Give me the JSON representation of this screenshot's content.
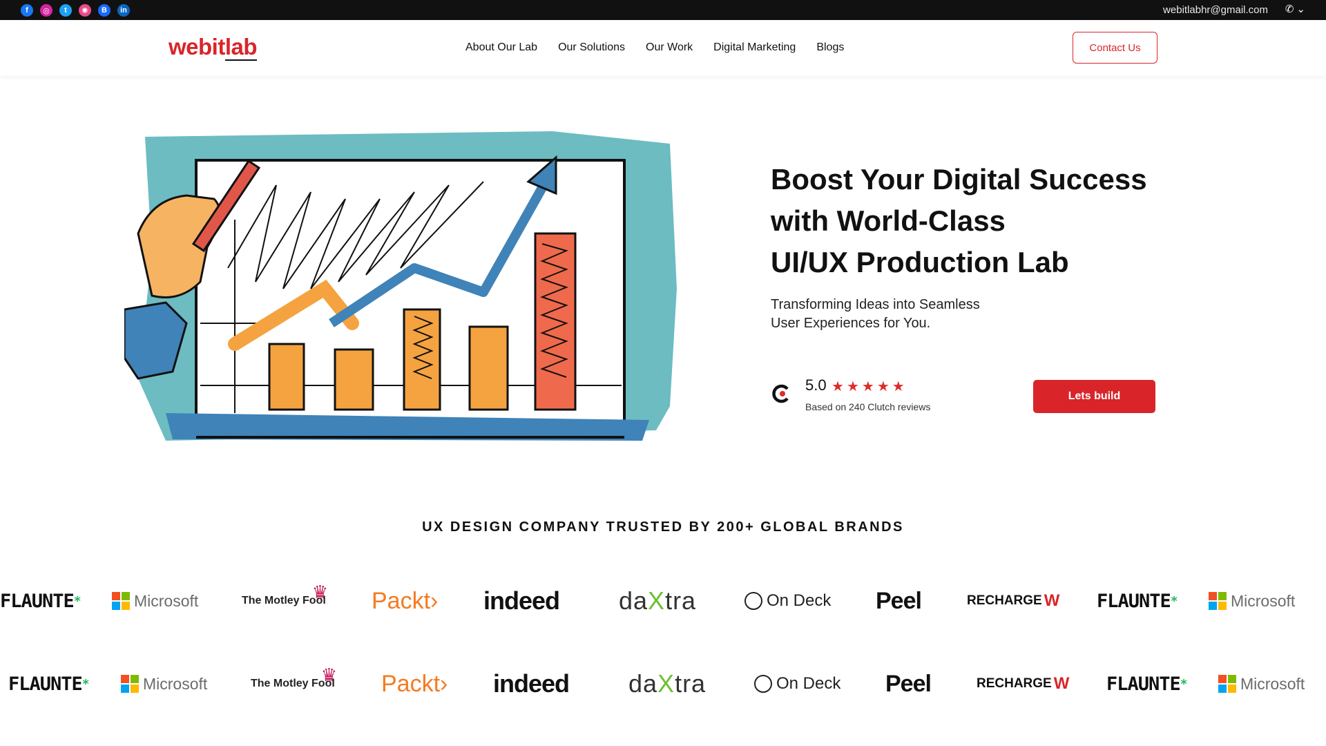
{
  "topbar": {
    "social_icons": [
      "facebook-icon",
      "instagram-icon",
      "twitter-icon",
      "dribbble-icon",
      "behance-icon",
      "linkedin-icon"
    ],
    "email": "webitlabhr@gmail.com",
    "phone_icon": "phone-icon",
    "dropdown_icon": "chevron-down-icon"
  },
  "nav": {
    "logo_main": "webit",
    "logo_accent": "lab",
    "items": [
      "About Our Lab",
      "Our Solutions",
      "Our Work",
      "Digital Marketing",
      "Blogs"
    ],
    "contact_label": "Contact Us"
  },
  "hero": {
    "title_line1": "Boost Your Digital Success",
    "title_line2": "with World-Class",
    "title_line3": "UI/UX Production Lab",
    "subtitle_line1": "Transforming Ideas into Seamless",
    "subtitle_line2": "User Experiences for You.",
    "rating_score": "5.0",
    "rating_stars": 5,
    "rating_caption": "Based on 240 Clutch reviews",
    "cta_label": "Lets build"
  },
  "brands": {
    "heading": "UX DESIGN COMPANY TRUSTED BY 200+ GLOBAL BRANDS",
    "flaunte": "FLAUNTE",
    "microsoft": "Microsoft",
    "fool_a": "The Motley",
    "fool_b": "Fool",
    "packt": "Packt",
    "indeed": "indeed",
    "daxtra_a": "da",
    "daxtra_x": "X",
    "daxtra_b": "tra",
    "ondeck": "On Deck",
    "peel": "Peel",
    "recharge": "RECHARGE"
  },
  "colors": {
    "brand_red": "#d9252a",
    "topbar_bg": "#111111",
    "star_red": "#e02b2b"
  }
}
